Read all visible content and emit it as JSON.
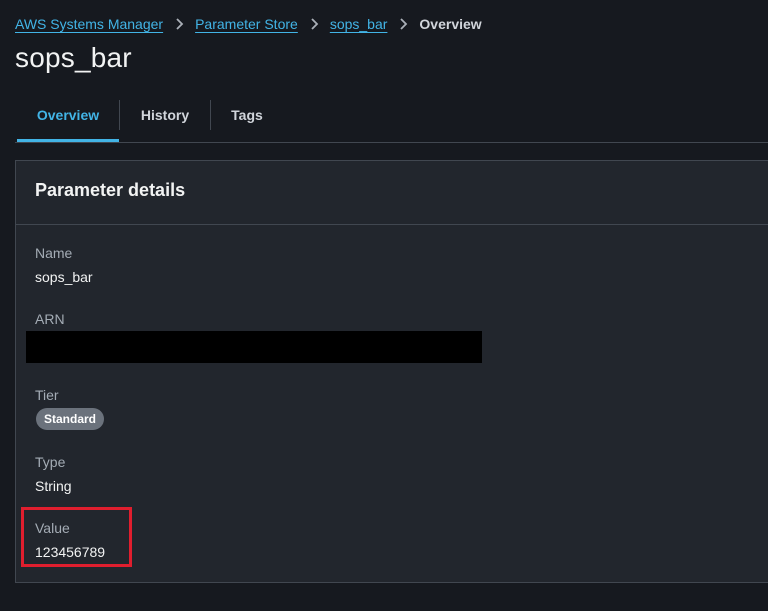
{
  "breadcrumb": {
    "items": [
      {
        "label": "AWS Systems Manager"
      },
      {
        "label": "Parameter Store"
      },
      {
        "label": "sops_bar"
      }
    ],
    "current": "Overview",
    "separator_icon": "chevron-right-icon"
  },
  "page": {
    "title": "sops_bar"
  },
  "tabs": [
    {
      "label": "Overview",
      "active": true
    },
    {
      "label": "History",
      "active": false
    },
    {
      "label": "Tags",
      "active": false
    }
  ],
  "details": {
    "title": "Parameter details",
    "name_label": "Name",
    "name_value": "sops_bar",
    "arn_label": "ARN",
    "arn_value": "",
    "tier_label": "Tier",
    "tier_value": "Standard",
    "type_label": "Type",
    "type_value": "String",
    "value_label": "Value",
    "value_value": "123456789"
  },
  "colors": {
    "background": "#16191f",
    "panel": "#22262d",
    "link": "#42b4e6",
    "highlight": "#e01e2e",
    "badge": "#6b727c"
  }
}
